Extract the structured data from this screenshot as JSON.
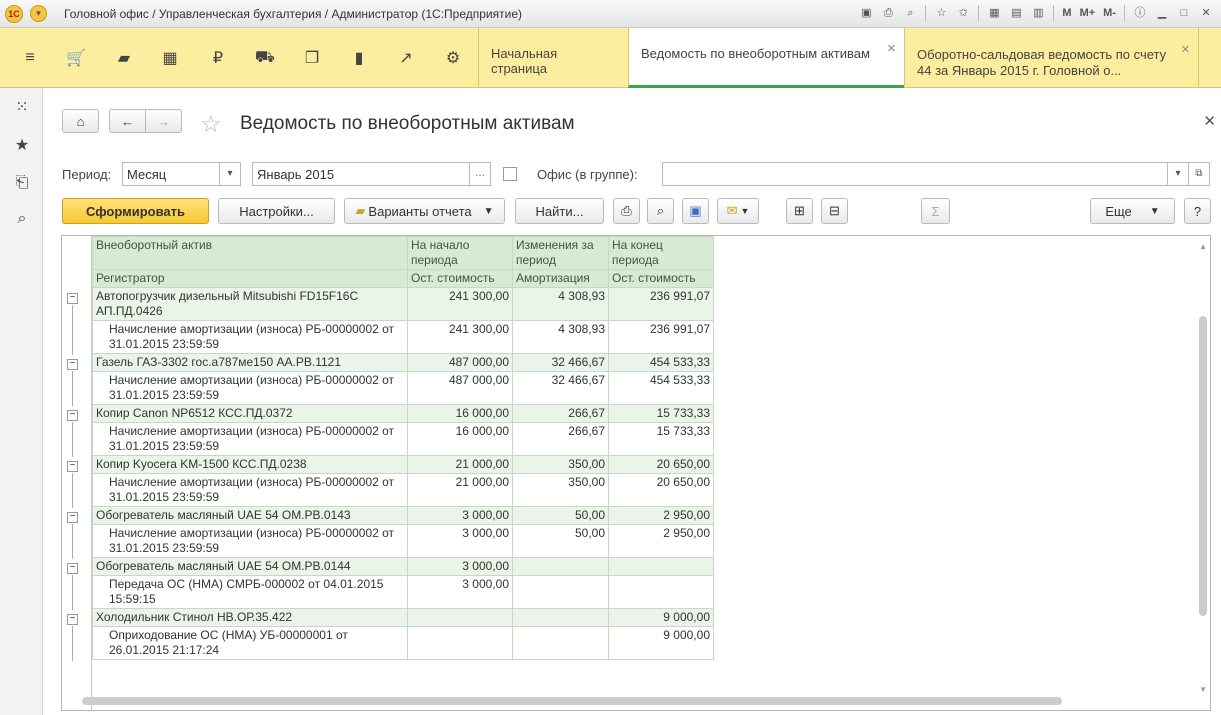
{
  "titlebar": {
    "logo": "1С",
    "title": "Головной офис / Управленческая бухгалтерия / Администратор  (1С:Предприятие)",
    "m": "M",
    "mplus": "M+",
    "mminus": "M-"
  },
  "sections": [
    "menu-icon",
    "cart-icon",
    "bag-icon",
    "grid-icon",
    "ruble-icon",
    "truck-icon",
    "docs-icon",
    "bar-chart-icon",
    "trend-icon",
    "gear-icon"
  ],
  "tabs": [
    {
      "label": "Начальная страница"
    },
    {
      "label": "Ведомость по внеоборотным активам"
    },
    {
      "label": "Оборотно-сальдовая ведомость по счету 44 за Январь 2015 г. Головной о..."
    }
  ],
  "page": {
    "title": "Ведомость по внеоборотным активам"
  },
  "filters": {
    "period_label": "Период:",
    "period_type": "Месяц",
    "period_value": "Январь 2015",
    "office_label": "Офис (в группе):",
    "office_value": ""
  },
  "toolbar": {
    "generate": "Сформировать",
    "settings": "Настройки...",
    "variants": "Варианты отчета",
    "find": "Найти...",
    "more": "Еще",
    "help": "?"
  },
  "table": {
    "headers": {
      "col1_top": "Внеоборотный актив",
      "col1_bottom": "Регистратор",
      "col2_top": "На начало периода",
      "col2_bottom": "Ост. стоимость",
      "col3_top": "Изменения за период",
      "col3_bottom": "Амортизация",
      "col4_top": "На конец периода",
      "col4_bottom": "Ост. стоимость"
    },
    "groups": [
      {
        "name": "Автопогрузчик дизельный Mitsubishi FD15F16C АП.ПД.0426",
        "start": "241 300,00",
        "change": "4 308,93",
        "end": "236 991,07",
        "detail": {
          "name": "Начисление амортизации (износа) РБ-00000002 от 31.01.2015 23:59:59",
          "start": "241 300,00",
          "change": "4 308,93",
          "end": "236 991,07"
        }
      },
      {
        "name": "Газель ГАЗ-3302 гос.а787ме150 АА.РВ.1121",
        "start": "487 000,00",
        "change": "32 466,67",
        "end": "454 533,33",
        "detail": {
          "name": "Начисление амортизации (износа) РБ-00000002 от 31.01.2015 23:59:59",
          "start": "487 000,00",
          "change": "32 466,67",
          "end": "454 533,33"
        }
      },
      {
        "name": "Копир Canon NP6512 КСС.ПД.0372",
        "start": "16 000,00",
        "change": "266,67",
        "end": "15 733,33",
        "detail": {
          "name": "Начисление амортизации (износа) РБ-00000002 от 31.01.2015 23:59:59",
          "start": "16 000,00",
          "change": "266,67",
          "end": "15 733,33"
        }
      },
      {
        "name": "Копир Kyocera KM-1500 КСС.ПД.0238",
        "start": "21 000,00",
        "change": "350,00",
        "end": "20 650,00",
        "detail": {
          "name": "Начисление амортизации (износа) РБ-00000002 от 31.01.2015 23:59:59",
          "start": "21 000,00",
          "change": "350,00",
          "end": "20 650,00"
        }
      },
      {
        "name": "Обогреватель масляный UAE 54 ОМ.РВ.0143",
        "start": "3 000,00",
        "change": "50,00",
        "end": "2 950,00",
        "detail": {
          "name": "Начисление амортизации (износа) РБ-00000002 от 31.01.2015 23:59:59",
          "start": "3 000,00",
          "change": "50,00",
          "end": "2 950,00"
        }
      },
      {
        "name": "Обогреватель масляный UAE 54 ОМ.РВ.0144",
        "start": "3 000,00",
        "change": "",
        "end": "",
        "detail": {
          "name": "Передача ОС (НМА) СМРБ-000002 от 04.01.2015 15:59:15",
          "start": "3 000,00",
          "change": "",
          "end": ""
        }
      },
      {
        "name": "Холодильник Стинол НВ.ОР.35.422",
        "start": "",
        "change": "",
        "end": "9 000,00",
        "detail": {
          "name": "Оприходование ОС (НМА) УБ-00000001 от 26.01.2015 21:17:24",
          "start": "",
          "change": "",
          "end": "9 000,00"
        }
      }
    ]
  }
}
